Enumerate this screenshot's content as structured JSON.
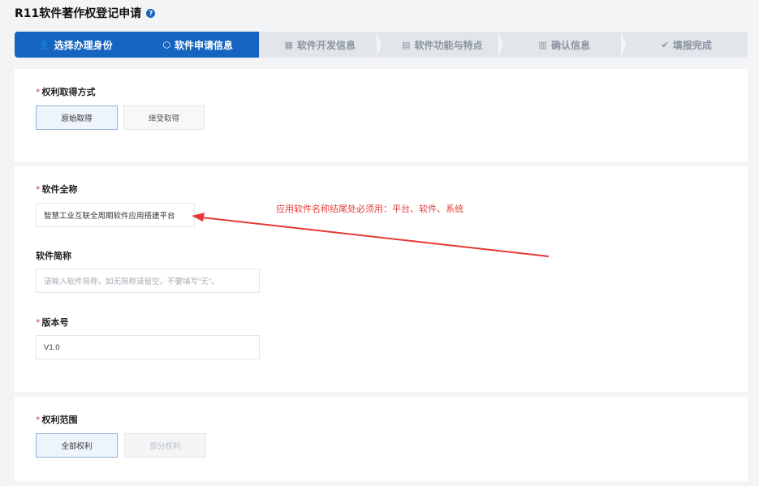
{
  "page": {
    "title": "R11软件著作权登记申请",
    "help_icon": "question-icon"
  },
  "steps": [
    {
      "label": "选择办理身份",
      "icon": "user-icon",
      "glyph": "👤",
      "active": true
    },
    {
      "label": "软件申请信息",
      "icon": "location-pin-icon",
      "glyph": "⬡",
      "active": true
    },
    {
      "label": "软件开发信息",
      "icon": "table-icon",
      "glyph": "▦",
      "active": false
    },
    {
      "label": "软件功能与特点",
      "icon": "document-icon",
      "glyph": "▤",
      "active": false
    },
    {
      "label": "确认信息",
      "icon": "clipboard-icon",
      "glyph": "▥",
      "active": false
    },
    {
      "label": "填报完成",
      "icon": "check-circle-icon",
      "glyph": "✔",
      "active": false
    }
  ],
  "rights_acquisition": {
    "label": "权利取得方式",
    "options": [
      "原始取得",
      "继受取得"
    ],
    "selected": "原始取得"
  },
  "software_info": {
    "full_name": {
      "label": "软件全称",
      "value": "智慧工业互联全周期软件应用搭建平台"
    },
    "short_name": {
      "label": "软件简称",
      "placeholder": "请输入软件简称，如无简称请留空，不要填写\"无\"。"
    },
    "version": {
      "label": "版本号",
      "value": "V1.0"
    }
  },
  "annotation": {
    "text": "应用软件名称结尾处必须用：平台、软件、系统",
    "color": "#e53935"
  },
  "rights_scope": {
    "label": "权利范围",
    "options": [
      "全部权利",
      "部分权利"
    ],
    "selected": "全部权利"
  },
  "colors": {
    "primary": "#1565c0",
    "required": "#e53935"
  }
}
